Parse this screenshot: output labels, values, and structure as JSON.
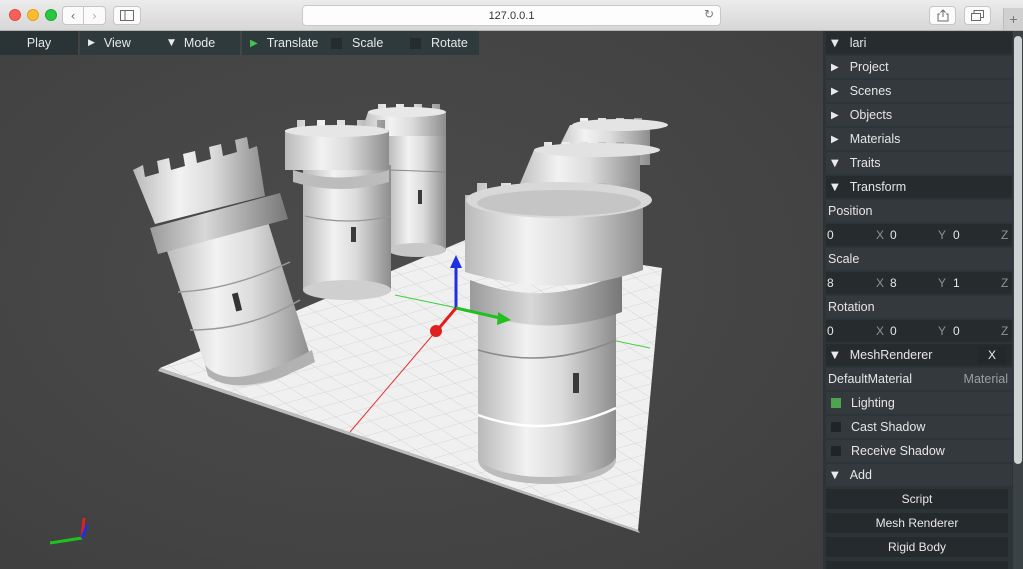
{
  "browser": {
    "url": "127.0.0.1",
    "back_glyph": "‹",
    "forward_glyph": "›",
    "reload_glyph": "↻",
    "newtab_glyph": "+",
    "sidebar_icon": "sidebar-icon",
    "share_icon": "share-icon",
    "tabs_icon": "tabs-icon"
  },
  "toolbar": {
    "play": "Play",
    "view": "View",
    "mode": "Mode",
    "translate": "Translate",
    "scale": "Scale",
    "rotate": "Rotate",
    "collapsed_glyph": "▶",
    "expanded_glyph": "▼",
    "active_glyph": "▶"
  },
  "panel": {
    "root": "lari",
    "project": "Project",
    "scenes": "Scenes",
    "objects": "Objects",
    "materials": "Materials",
    "traits": "Traits",
    "transform": {
      "title": "Transform",
      "position_label": "Position",
      "position": {
        "x": "0",
        "y": "0",
        "z": "0"
      },
      "scale_label": "Scale",
      "scale": {
        "x": "8",
        "y": "8",
        "z": "1"
      },
      "rotation_label": "Rotation",
      "rotation": {
        "x": "0",
        "y": "0",
        "z": "0"
      },
      "axis_x": "X",
      "axis_y": "Y",
      "axis_z": "Z"
    },
    "mesh_renderer": {
      "title": "MeshRenderer",
      "remove": "X",
      "material_name": "DefaultMaterial",
      "material_label": "Material",
      "lighting": "Lighting",
      "lighting_checked": true,
      "cast_shadow": "Cast Shadow",
      "cast_shadow_checked": false,
      "receive_shadow": "Receive Shadow",
      "receive_shadow_checked": false
    },
    "add": {
      "title": "Add",
      "script": "Script",
      "mesh_renderer": "Mesh Renderer",
      "rigid_body": "Rigid Body"
    }
  },
  "colors": {
    "panel_bg": "#2c3437",
    "toolbar_bg": "#2f3a3d",
    "play_green": "#44c44c",
    "checkbox_on": "#4da64d",
    "axis_x": "#e02020",
    "axis_y": "#20c020",
    "axis_z": "#2030e0"
  }
}
